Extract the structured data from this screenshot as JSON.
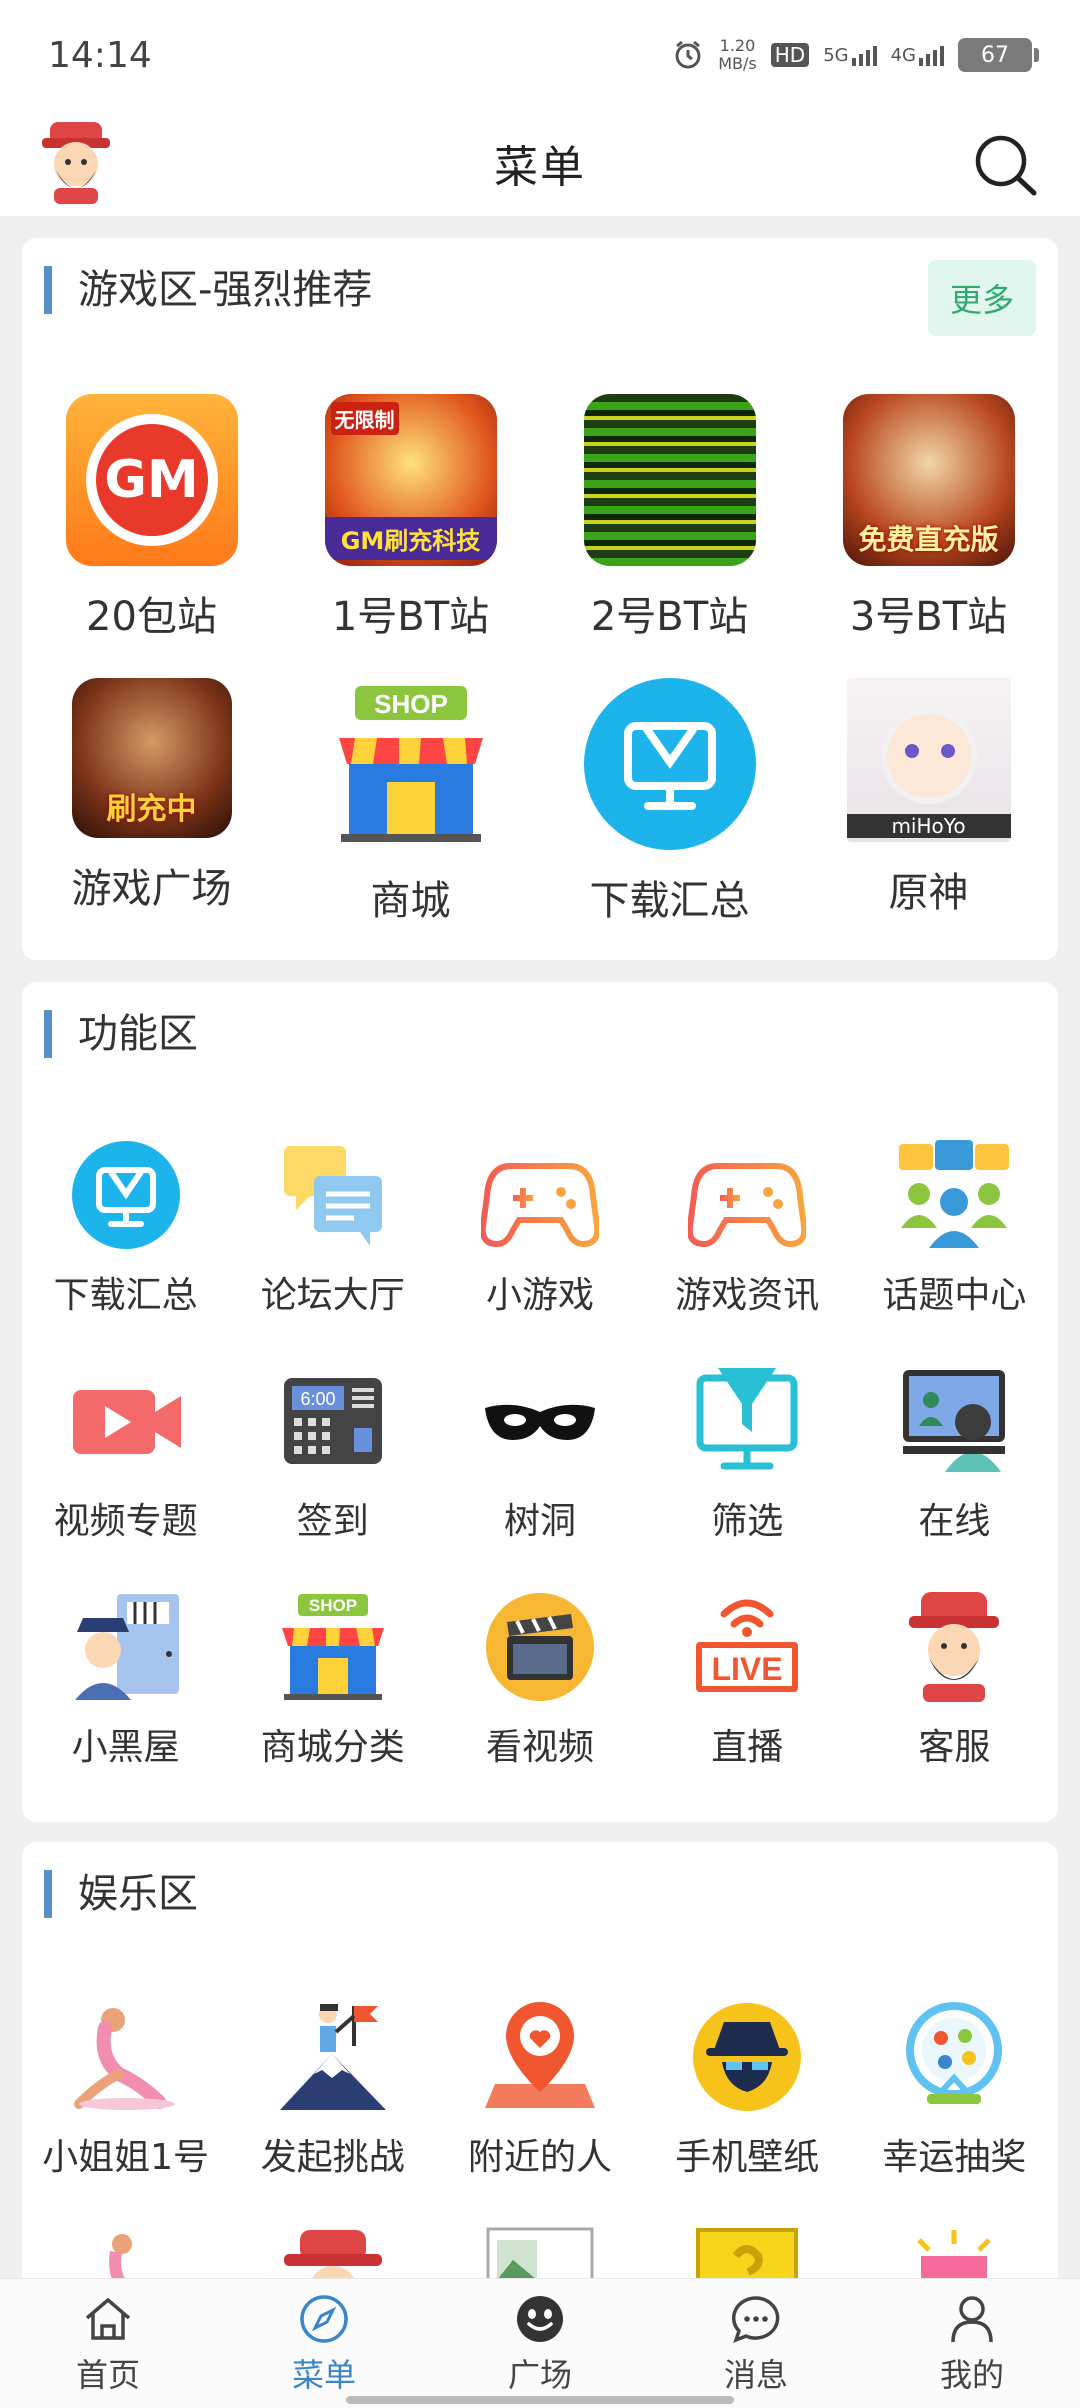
{
  "status": {
    "time": "14:14",
    "speed_top": "1.20",
    "speed_bottom": "MB/s",
    "hd": "HD",
    "net1": "5G",
    "net2": "4G",
    "battery": "67"
  },
  "header": {
    "title": "菜单"
  },
  "game_section": {
    "title": "游戏区-强烈推荐",
    "more_label": "更多",
    "items": [
      {
        "label": "20包站",
        "icon": "gm-icon",
        "tile_text": "GM"
      },
      {
        "label": "1号BT站",
        "icon": "gm-recharge-icon",
        "tile_text": "GM刷充科技",
        "tile_top": "无限制"
      },
      {
        "label": "2号BT站",
        "icon": "glitch-game-icon"
      },
      {
        "label": "3号BT站",
        "icon": "free-direct-icon",
        "tile_text": "免费直充版"
      },
      {
        "label": "游戏广场",
        "icon": "recharging-game-icon",
        "tile_text": "刷充中"
      },
      {
        "label": "商城",
        "icon": "shop-icon",
        "tile_text": "SHOP"
      },
      {
        "label": "下载汇总",
        "icon": "download-summary-icon"
      },
      {
        "label": "原神",
        "icon": "genshin-icon",
        "tile_text": "miHoYo"
      }
    ]
  },
  "function_section": {
    "title": "功能区",
    "items": [
      {
        "label": "下载汇总",
        "icon": "download-summary-icon"
      },
      {
        "label": "论坛大厅",
        "icon": "chat-bubbles-icon"
      },
      {
        "label": "小游戏",
        "icon": "gamepad-icon"
      },
      {
        "label": "游戏资讯",
        "icon": "gamepad-icon"
      },
      {
        "label": "话题中心",
        "icon": "topic-people-icon"
      },
      {
        "label": "视频专题",
        "icon": "video-camera-icon"
      },
      {
        "label": "签到",
        "icon": "checkin-clock-icon",
        "tile_text": "6:00"
      },
      {
        "label": "树洞",
        "icon": "mask-icon"
      },
      {
        "label": "筛选",
        "icon": "filter-monitor-icon"
      },
      {
        "label": "在线",
        "icon": "online-monitor-icon"
      },
      {
        "label": "小黑屋",
        "icon": "police-door-icon"
      },
      {
        "label": "商城分类",
        "icon": "shop-icon",
        "tile_text": "SHOP"
      },
      {
        "label": "看视频",
        "icon": "clapperboard-icon"
      },
      {
        "label": "直播",
        "icon": "live-icon",
        "tile_text": "LIVE"
      },
      {
        "label": "客服",
        "icon": "god-of-wealth-icon"
      }
    ]
  },
  "entertainment_section": {
    "title": "娱乐区",
    "items": [
      {
        "label": "小姐姐1号",
        "icon": "yoga-icon"
      },
      {
        "label": "发起挑战",
        "icon": "summit-flag-icon"
      },
      {
        "label": "附近的人",
        "icon": "location-heart-icon"
      },
      {
        "label": "手机壁纸",
        "icon": "spy-icon"
      },
      {
        "label": "幸运抽奖",
        "icon": "lottery-wheel-icon"
      }
    ]
  },
  "tabbar": {
    "items": [
      {
        "label": "首页",
        "icon": "home-icon",
        "active": false
      },
      {
        "label": "菜单",
        "icon": "compass-icon",
        "active": true
      },
      {
        "label": "广场",
        "icon": "smile-icon",
        "active": false
      },
      {
        "label": "消息",
        "icon": "message-icon",
        "active": false
      },
      {
        "label": "我的",
        "icon": "user-icon",
        "active": false
      }
    ]
  },
  "colors": {
    "accent": "#5a8fc7",
    "active_tab": "#3a86c8",
    "more_bg": "#e0f6ee",
    "more_text": "#2fa96d"
  }
}
